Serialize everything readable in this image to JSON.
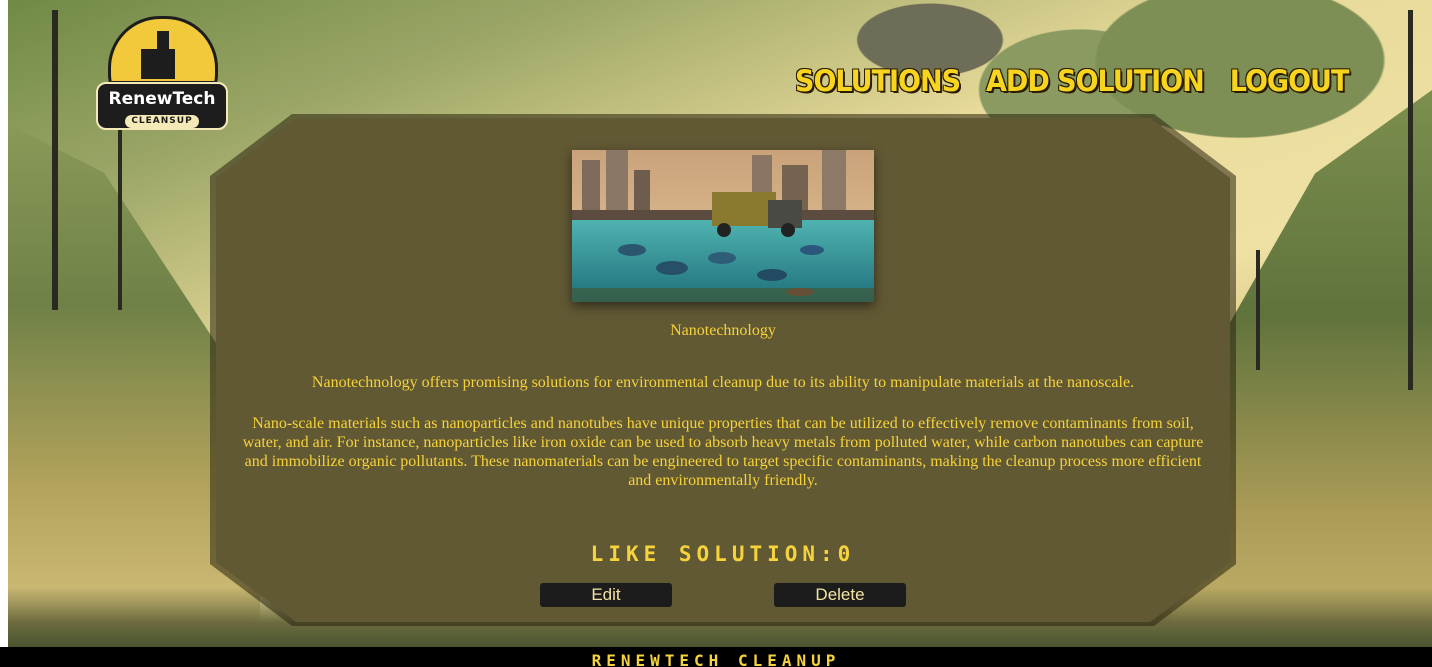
{
  "brand": {
    "name": "RenewTech",
    "tagline": "CLEANSUP"
  },
  "nav": {
    "items": [
      "SOLUTIONS",
      "ADD SOLUTION",
      "LOGOUT"
    ]
  },
  "solution": {
    "image_alt": "Nanotechnology",
    "title": "Nanotechnology",
    "summary": "Nanotechnology offers promising solutions for environmental cleanup due to its ability to manipulate materials at the nanoscale.",
    "details": "Nano-scale materials such as nanoparticles and nanotubes have unique properties that can be utilized to effectively remove contaminants from soil, water, and air. For instance, nanoparticles like iron oxide can be used to absorb heavy metals from polluted water, while carbon nanotubes can capture and immobilize organic pollutants. These nanomaterials can be engineered to target specific contaminants, making the cleanup process more efficient and environmentally friendly.",
    "like_label": "LIKE SOLUTION:0"
  },
  "actions": {
    "edit_label": "Edit",
    "delete_label": "Delete"
  },
  "footer": {
    "text": "RENEWTECH CLEANUP"
  },
  "colors": {
    "accent": "#f6d33a",
    "card": "#615834",
    "button": "#1c1c1c"
  }
}
